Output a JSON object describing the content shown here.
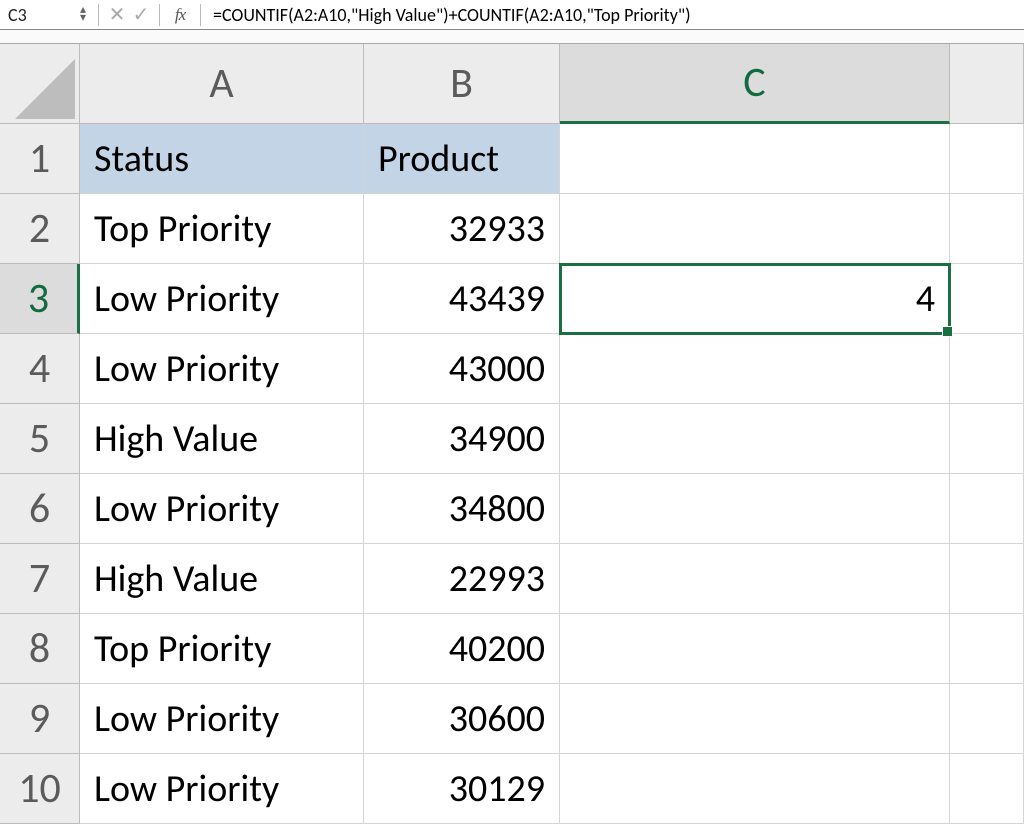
{
  "formula_bar": {
    "cell_ref": "C3",
    "fx_label": "fx",
    "formula": "=COUNTIF(A2:A10,\"High Value\")+COUNTIF(A2:A10,\"Top Priority\")"
  },
  "stepper": {
    "up": "▴",
    "down": "▾"
  },
  "toolbar_icons": {
    "cancel": "✕",
    "confirm": "✓"
  },
  "columns": [
    "A",
    "B",
    "C",
    ""
  ],
  "rows": [
    "1",
    "2",
    "3",
    "4",
    "5",
    "6",
    "7",
    "8",
    "9",
    "10"
  ],
  "headers": {
    "A1": "Status",
    "B1": "Product"
  },
  "data": {
    "colA": [
      "Top Priority",
      "Low Priority",
      "Low Priority",
      "High Value",
      "Low Priority",
      "High Value",
      "Top Priority",
      "Low Priority",
      "Low Priority"
    ],
    "colB": [
      "32933",
      "43439",
      "43000",
      "34900",
      "34800",
      "22993",
      "40200",
      "30600",
      "30129"
    ],
    "C3": "4"
  },
  "active_cell": "C3"
}
